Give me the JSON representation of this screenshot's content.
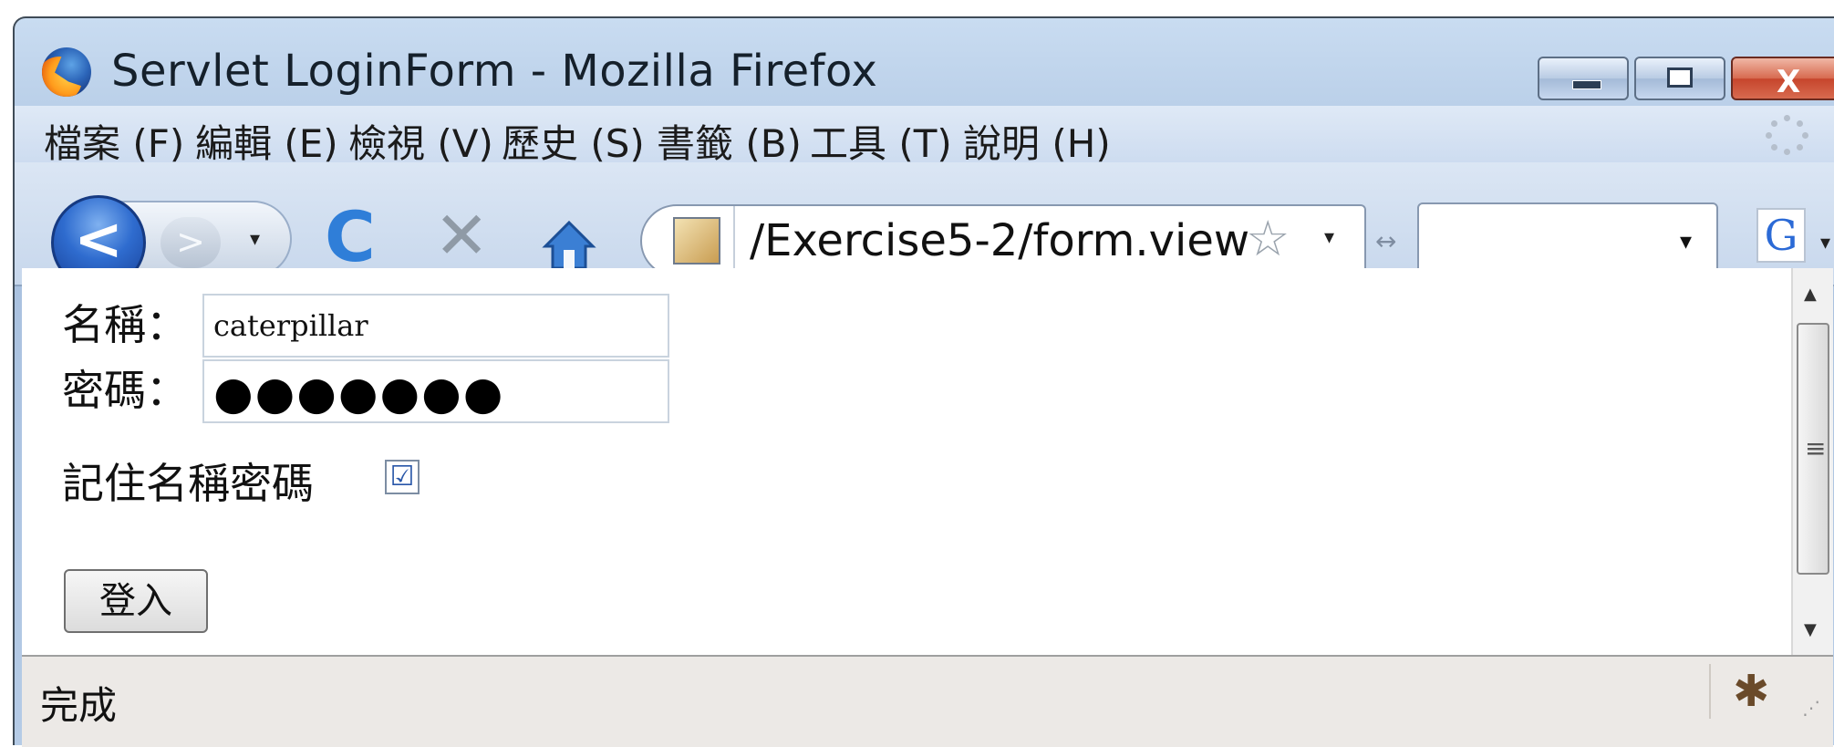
{
  "window": {
    "title": "Servlet LoginForm - Mozilla Firefox",
    "minimize": "",
    "maximize": "",
    "close": "X"
  },
  "menu": [
    "檔案 (F)",
    "編輯 (E)",
    "檢視 (V)",
    "歷史 (S)",
    "書籤 (B)",
    "工具 (T)",
    "說明 (H)"
  ],
  "nav": {
    "back_glyph": "<",
    "forward_glyph": ">",
    "reload_glyph": "C",
    "stop_glyph": "✕",
    "url": "/Exercise5-2/form.view",
    "star_glyph": "☆",
    "search_value": "",
    "search_engine_glyph": "G",
    "dropdown_glyph": "▾"
  },
  "form": {
    "name_label": "名稱：",
    "name_value": "caterpillar",
    "password_label": "密碼：",
    "password_masked": "●●●●●●●",
    "remember_label": "記住名稱密碼",
    "remember_checked": true,
    "checkbox_glyph": "☑",
    "login_button": "登入"
  },
  "status": {
    "text": "完成"
  },
  "icons": {
    "browser": "firefox-logo-icon",
    "back": "back-arrow-icon",
    "forward": "forward-arrow-icon",
    "reload": "reload-icon",
    "stop": "stop-icon",
    "home": "home-icon",
    "site": "site-identity-icon",
    "bookmark": "star-icon",
    "search_engine": "google-icon",
    "throbber": "throbber-icon",
    "firebug": "firebug-icon"
  },
  "colors": {
    "titlebar": "#b7cde7",
    "back_button": "#2f6ccf",
    "reload": "#2f7ed8",
    "close_button": "#c6452c",
    "statusbar": "#ece9e6"
  }
}
